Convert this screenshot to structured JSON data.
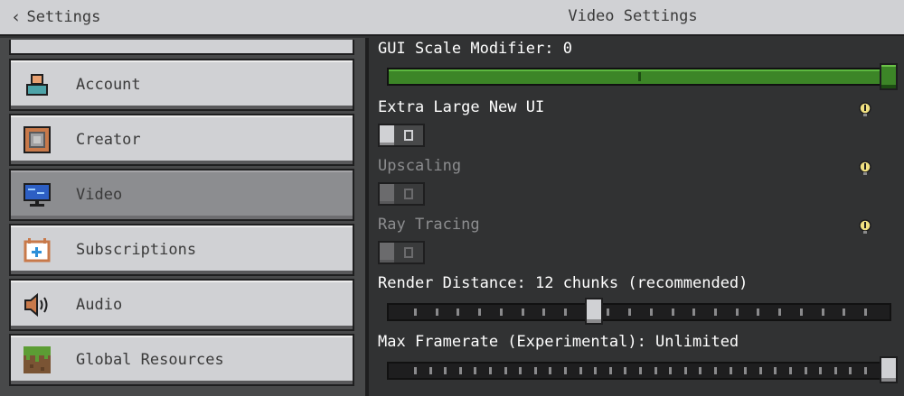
{
  "header": {
    "back_label": "Settings",
    "title": "Video Settings"
  },
  "sidebar": {
    "items": [
      {
        "label": "Account",
        "icon": "account-icon"
      },
      {
        "label": "Creator",
        "icon": "creator-icon"
      },
      {
        "label": "Video",
        "icon": "video-monitor-icon",
        "active": true
      },
      {
        "label": "Subscriptions",
        "icon": "subscriptions-icon"
      },
      {
        "label": "Audio",
        "icon": "speaker-icon"
      },
      {
        "label": "Global Resources",
        "icon": "grass-block-icon"
      }
    ]
  },
  "settings": {
    "gui_scale": {
      "label": "GUI Scale Modifier: 0",
      "value": 1.0
    },
    "extra_large_ui": {
      "label": "Extra Large New UI",
      "enabled": false
    },
    "upscaling": {
      "label": "Upscaling",
      "enabled": false,
      "disabled": true
    },
    "ray_tracing": {
      "label": "Ray Tracing",
      "enabled": false,
      "disabled": true
    },
    "render_distance": {
      "label": "Render Distance: 12 chunks (recommended)",
      "value": 12,
      "ticks": 22
    },
    "max_framerate": {
      "label": "Max Framerate (Experimental): Unlimited",
      "value": 1.0,
      "ticks": 31
    }
  },
  "colors": {
    "accent_green": "#3c8527",
    "panel": "#313233",
    "sidebar_button": "#d0d1d4",
    "info_icon": "#f0e080"
  }
}
